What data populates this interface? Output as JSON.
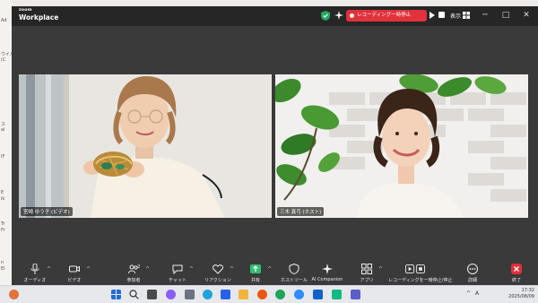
{
  "desktop": {
    "left_labels": [
      "Ad",
      "ウイル",
      "(C",
      "ス",
      "al",
      "IF",
      "E",
      "ik",
      "Tr",
      "Fr",
      "n",
      "El"
    ]
  },
  "window": {
    "logo_top": "zoom",
    "logo_bottom": "Workplace",
    "recording_label": "レコーディング一時停止",
    "view_label": "表示",
    "controls": [
      "─",
      "□",
      "✕"
    ]
  },
  "participants": [
    {
      "name": "宮崎 ゆう子 (ビデオ)",
      "icon": "speaker"
    },
    {
      "name": "三木 真弓 (ホスト)",
      "icon": "host"
    }
  ],
  "toolbar": {
    "items": [
      {
        "label": "オーディオ",
        "icon": "mic-icon"
      },
      {
        "label": "ビデオ",
        "icon": "camera-icon"
      },
      {
        "label": "参加者",
        "icon": "participants-icon",
        "count": "2"
      },
      {
        "label": "チャット",
        "icon": "chat-icon"
      },
      {
        "label": "リアクション",
        "icon": "heart-icon"
      },
      {
        "label": "共有",
        "icon": "share-icon"
      },
      {
        "label": "ホストツール",
        "icon": "shield-icon"
      },
      {
        "label": "AI Companion",
        "icon": "sparkle-icon"
      },
      {
        "label": "アプリ",
        "icon": "apps-icon"
      },
      {
        "label": "レコーディングを一時停止/停止",
        "icon": "record-icon"
      },
      {
        "label": "詳細",
        "icon": "more-icon"
      },
      {
        "label": "終了",
        "icon": "end-icon"
      }
    ]
  },
  "taskbar": {
    "time": "17:32",
    "date": "2025/08/09",
    "tray": [
      "^",
      "A"
    ],
    "colors": {
      "windows": "#1f6ed4",
      "accent": "#e0323b"
    }
  }
}
